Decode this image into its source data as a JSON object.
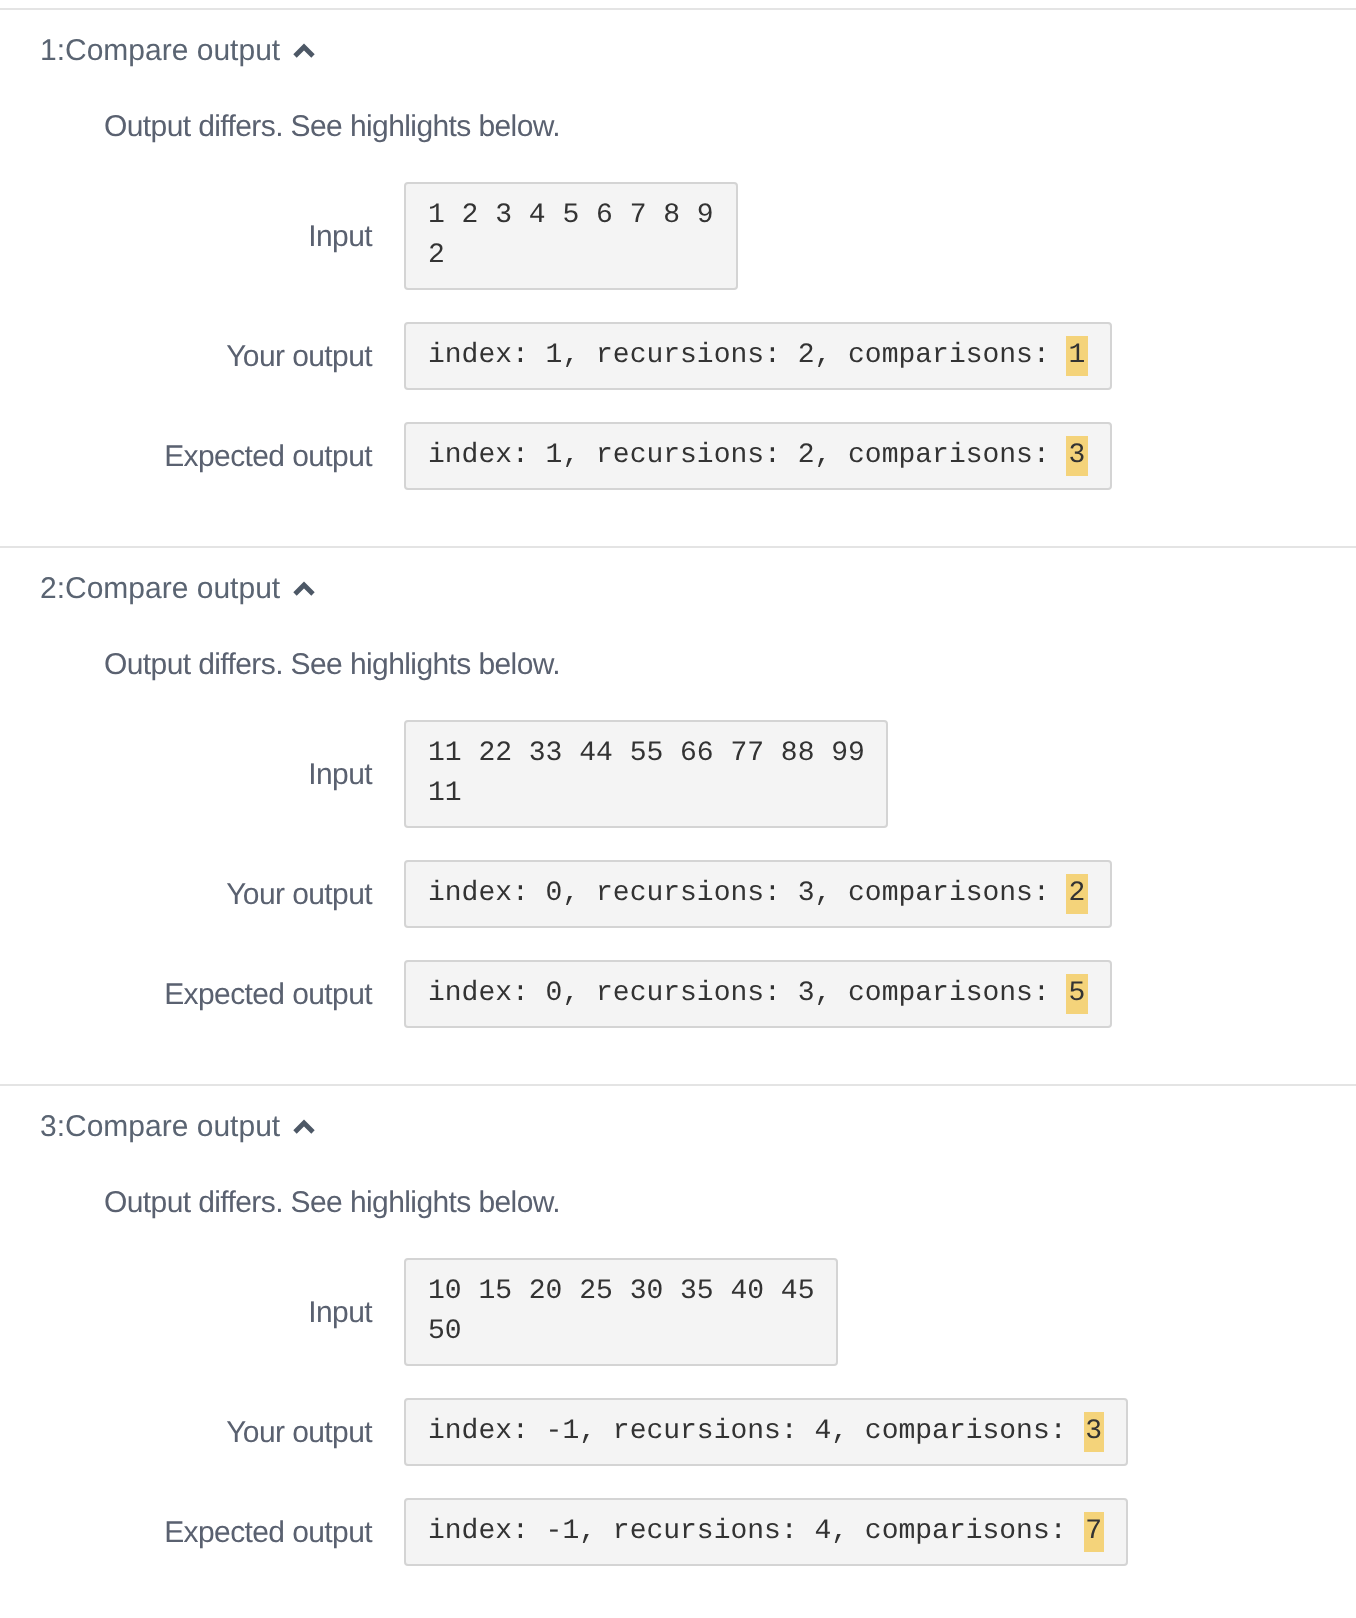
{
  "tests": [
    {
      "title": "1:Compare output",
      "expanded": true,
      "message": "Output differs. See highlights below.",
      "input_label": "Input",
      "input_lines": [
        "1 2 3 4 5 6 7 8 9",
        "2"
      ],
      "your_label": "Your output",
      "your_output": {
        "text": "index: 1, recursions: 2, comparisons:",
        "highlight": "1"
      },
      "expected_label": "Expected output",
      "expected_output": {
        "text": "index: 1, recursions: 2, comparisons:",
        "highlight": "3"
      }
    },
    {
      "title": "2:Compare output",
      "expanded": true,
      "message": "Output differs. See highlights below.",
      "input_label": "Input",
      "input_lines": [
        "11 22 33 44 55 66 77 88 99",
        "11"
      ],
      "your_label": "Your output",
      "your_output": {
        "text": "index: 0, recursions: 3, comparisons:",
        "highlight": "2"
      },
      "expected_label": "Expected output",
      "expected_output": {
        "text": "index: 0, recursions: 3, comparisons:",
        "highlight": "5"
      }
    },
    {
      "title": "3:Compare output",
      "expanded": true,
      "message": "Output differs. See highlights below.",
      "input_label": "Input",
      "input_lines": [
        "10 15 20 25 30 35 40 45",
        "50"
      ],
      "your_label": "Your output",
      "your_output": {
        "text": "index: -1, recursions: 4, comparisons:",
        "highlight": "3"
      },
      "expected_label": "Expected output",
      "expected_output": {
        "text": "index: -1, recursions: 4, comparisons:",
        "highlight": "7"
      }
    }
  ]
}
